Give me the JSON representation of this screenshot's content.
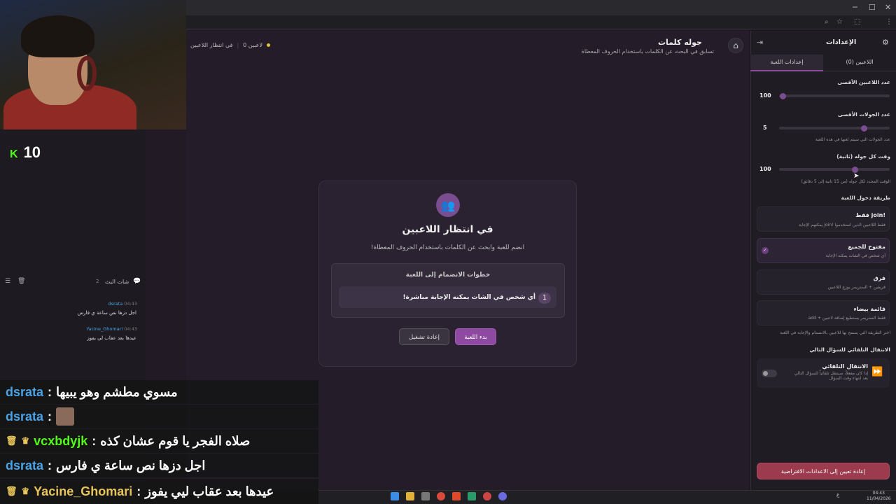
{
  "browser": {
    "minimize": "─",
    "maximize": "☐",
    "close": "✕"
  },
  "header": {
    "title": "جوله كلمات",
    "subtitle": "تسابق في البحث عن الكلمات باستخدام الحروف المعطاة",
    "status_waiting": "في انتظار اللاعبين",
    "status_players": "0 لاعبين"
  },
  "stream": {
    "kick_count": "10"
  },
  "card": {
    "title": "في انتظار اللاعبين",
    "subtitle": "انضم للعبة وابحث عن الكلمات باستخدام الحروف المعطاة!",
    "steps_title": "خطوات الانضمام إلى اللعبة",
    "step_number": "1",
    "step_text": "أي شخص في الشات يمكنه الإجابة مباشرة!",
    "start_button": "بدء اللعبة",
    "reset_button": "إعادة تشغيل"
  },
  "settings": {
    "title": "الإعدادات",
    "tab_game": "إعدادات اللعبة",
    "tab_players": "اللاعبين (0)",
    "max_players_label": "عدد اللاعبين الأقصى",
    "max_players_value": "100",
    "max_rounds_label": "عدد الجولات الأقصى",
    "max_rounds_value": "5",
    "max_rounds_hint": "عدد الجولات التي سيتم لعبها في هذه اللعبة",
    "round_time_label": "وقت كل جوله (ثانية)",
    "round_time_value": "100",
    "round_time_hint": "الوقت المحدد لكل جوله (من 15 ثانية إلى 5 دقائق)",
    "entry_label": "طريقة دخول اللعبة",
    "options": [
      {
        "title": "!join فقط",
        "desc": "فقط اللاعبين الذين استخدموا !join يمكنهم الإجابة"
      },
      {
        "title": "مفتوح للجميع",
        "desc": "أي شخص في الشات يمكنه الإجابة"
      },
      {
        "title": "فرق",
        "desc": "فريقين + الستريمر يوزع اللاعبين"
      },
      {
        "title": "قائمة بيضاء",
        "desc": "فقط الستريمر يستطيع إضافة لاعبين + add"
      }
    ],
    "entry_hint": "اختر الطريقة التي يسمح بها للاعبين بالانضمام والإجابة في اللعبة",
    "auto_label": "الانتقال التلقائي للسؤال التالي",
    "auto_title": "الانتقال التلقائي",
    "auto_desc": "إذا كان مفعلاً، سينتقل تلقائياً للسؤال التالي بعد انتهاء وقت السؤال",
    "reset_all": "إعادة تعيين إلى الاعدادات الافتراضية"
  },
  "chat_panel": {
    "title": "شات البث",
    "count": "2",
    "messages": [
      {
        "time": "04:43",
        "user": "dsrata",
        "text": "اجل دزها نص ساعة ي فارس"
      },
      {
        "time": "04:43",
        "user": "Yacine_Ghomari",
        "text": "عيدها بعد عقاب لي يفوز"
      }
    ]
  },
  "overlay": [
    {
      "user": "dsrata",
      "text": "مسوي مطشم وهو يبيها"
    },
    {
      "user": "dsrata",
      "text": ""
    },
    {
      "user": "vcxbdyjk",
      "text": "صلاه الفجر يا قوم عشان كذه"
    },
    {
      "user": "dsrata",
      "text": "اجل دزها نص ساعة ي فارس"
    },
    {
      "user": "Yacine_Ghomari",
      "text": "عيدها بعد عقاب ليي يفوز"
    }
  ],
  "taskbar": {
    "time": "04:43",
    "date": "11/04/2026",
    "lang": "ع"
  }
}
